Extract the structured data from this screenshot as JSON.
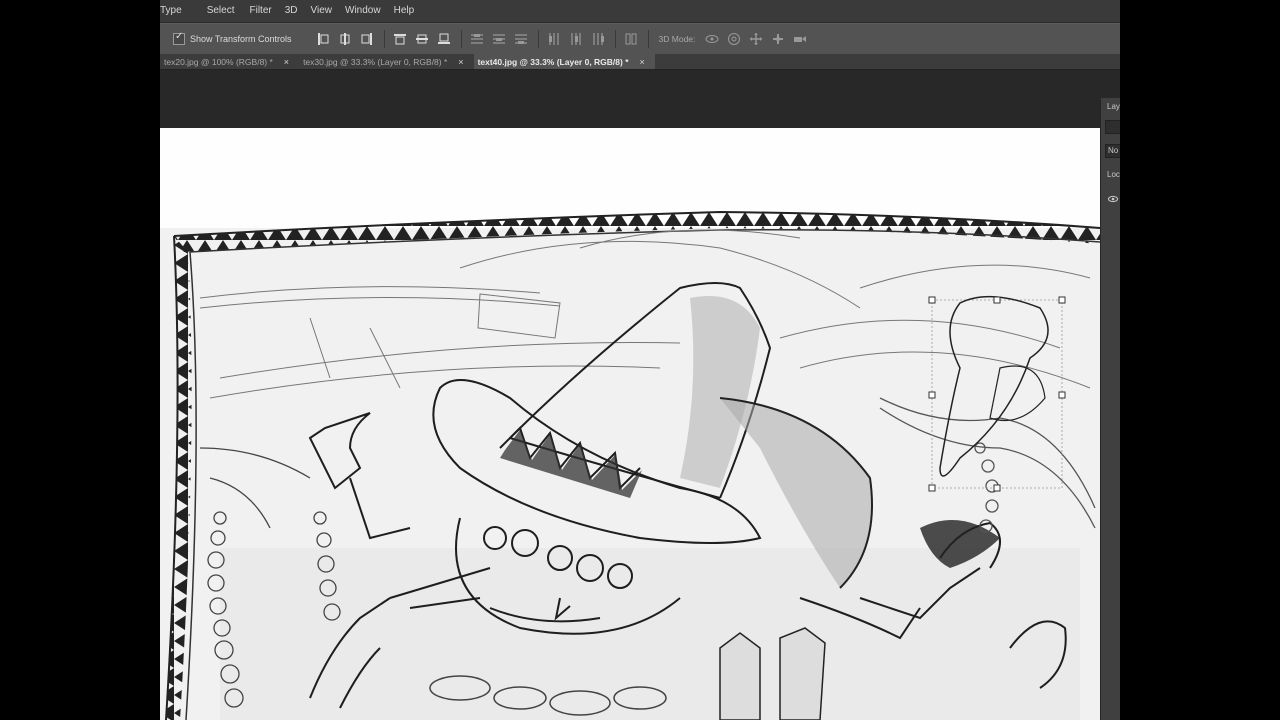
{
  "menu": [
    "Type",
    "Select",
    "Filter",
    "3D",
    "View",
    "Window",
    "Help"
  ],
  "options": {
    "show_transform_controls": "Show Transform Controls",
    "mode_3d": "3D Mode:"
  },
  "tabs": [
    {
      "label": "tex20.jpg @ 100% (RGB/8) *",
      "active": false
    },
    {
      "label": "tex30.jpg @ 33.3% (Layer 0, RGB/8) *",
      "active": false
    },
    {
      "label": "text40.jpg @ 33.3% (Layer 0, RGB/8) *",
      "active": true
    }
  ],
  "tab_close": "×",
  "layers_panel": {
    "title": "Lay",
    "blend": "No",
    "lock": "Lock"
  },
  "colors": {
    "menubar": "#3a3a3a",
    "optionsbar": "#535353",
    "tabbar": "#3c3c3c",
    "workspace": "#282828",
    "canvas": "#fefefe",
    "pencil": "#2a2a2a"
  }
}
